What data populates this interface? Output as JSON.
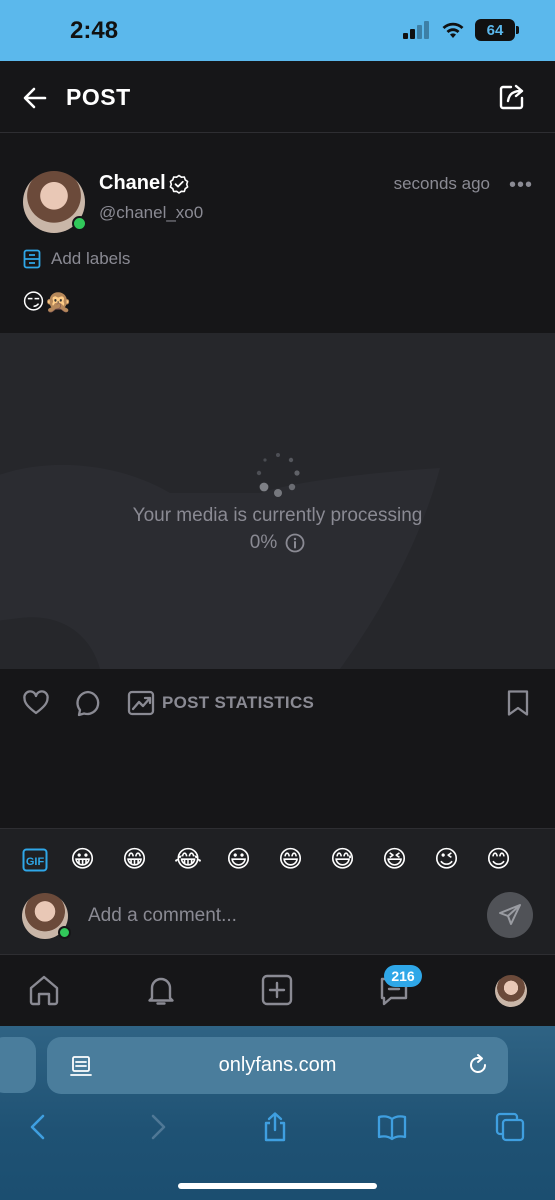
{
  "status_bar": {
    "time": "2:48",
    "battery": "64",
    "icons": [
      "signal-icon",
      "wifi-icon",
      "battery-icon"
    ]
  },
  "header": {
    "title": "POST",
    "back_icon": "arrow-left-icon",
    "share_icon": "share-icon"
  },
  "post": {
    "author_name": "Chanel",
    "handle": "@chanel_xo0",
    "time": "seconds ago",
    "more": "•••",
    "labels_text": "Add labels",
    "text": "😏🙊",
    "online": true
  },
  "media": {
    "status_text": "Your media is currently processing",
    "progress": "0%",
    "progress_value": 0
  },
  "actions": {
    "stats_label": "POST STATISTICS"
  },
  "comments": {
    "quick_emojis": [
      "😀",
      "😁",
      "😂",
      "😃",
      "😄",
      "😅",
      "😆",
      "😉",
      "😊"
    ],
    "placeholder": "Add a comment..."
  },
  "tabbar": {
    "messages_badge": "216"
  },
  "browser": {
    "url": "onlyfans.com"
  },
  "colors": {
    "accent": "#2fa7e8",
    "background": "#161618",
    "muted": "#8a8a93",
    "online": "#31c85a",
    "safari": "#1f5274"
  }
}
